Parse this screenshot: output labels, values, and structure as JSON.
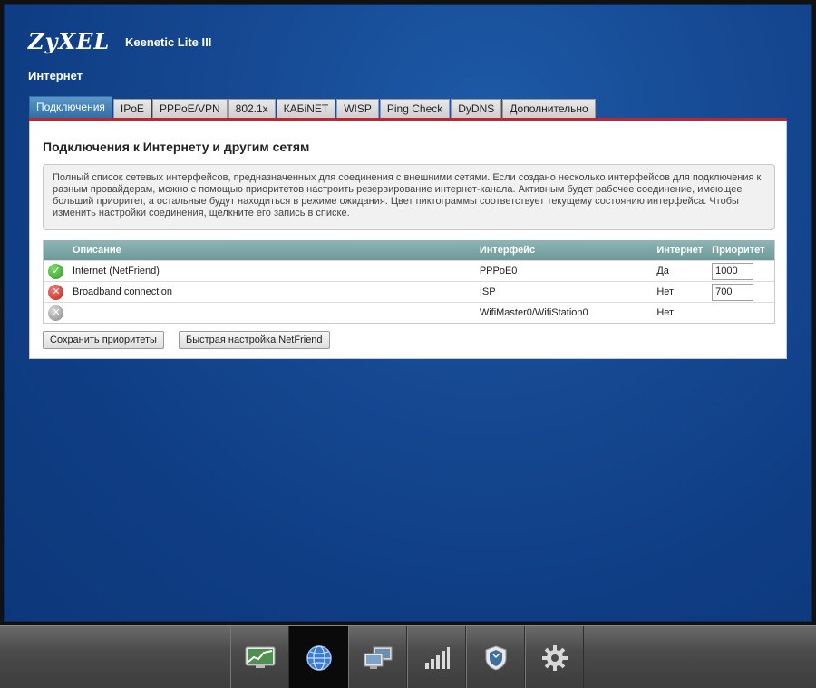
{
  "header": {
    "brand": "ZyXEL",
    "model": "Keenetic Lite III",
    "page_title": "Интернет"
  },
  "tabs": [
    {
      "label": "Подключения",
      "active": true
    },
    {
      "label": "IPoE"
    },
    {
      "label": "PPPoE/VPN"
    },
    {
      "label": "802.1x"
    },
    {
      "label": "КАБiNET"
    },
    {
      "label": "WISP"
    },
    {
      "label": "Ping Check"
    },
    {
      "label": "DyDNS"
    },
    {
      "label": "Дополнительно"
    }
  ],
  "panel": {
    "title": "Подключения к Интернету и другим сетям",
    "info": "Полный список сетевых интерфейсов, предназначенных для соединения с внешними сетями. Если создано несколько интерфейсов для подключения к разным провайдерам, можно с помощью приоритетов настроить резервирование интернет-канала. Активным будет рабочее соединение, имеющее больший приоритет, а остальные будут находиться в режиме ожидания. Цвет пиктограммы соответствует текущему состоянию интерфейса. Чтобы изменить настройки соединения, щелкните его запись в списке."
  },
  "table": {
    "headers": {
      "description": "Описание",
      "interface": "Интерфейс",
      "internet": "Интернет",
      "priority": "Приоритет"
    },
    "rows": [
      {
        "status": "ok",
        "status_icon": "check-icon",
        "description": "Internet (NetFriend)",
        "interface": "PPPoE0",
        "internet": "Да",
        "priority": "1000"
      },
      {
        "status": "error",
        "status_icon": "error-x-icon",
        "description": "Broadband connection",
        "interface": "ISP",
        "internet": "Нет",
        "priority": "700"
      },
      {
        "status": "disabled",
        "status_icon": "disabled-x-icon",
        "description": "",
        "interface": "WifiMaster0/WifiStation0",
        "internet": "Нет",
        "priority": ""
      }
    ]
  },
  "buttons": {
    "save_priorities": "Сохранить приоритеты",
    "quick_setup": "Быстрая настройка NetFriend"
  },
  "taskbar": {
    "items": [
      {
        "icon": "monitor-chart-icon"
      },
      {
        "icon": "globe-icon",
        "active": true
      },
      {
        "icon": "network-computers-icon"
      },
      {
        "icon": "signal-bars-icon"
      },
      {
        "icon": "security-shield-icon"
      },
      {
        "icon": "settings-gear-icon"
      }
    ]
  },
  "colors": {
    "background_blue": "#164a93",
    "accent_red": "#c8222d",
    "tab_active": "#2f6fa6",
    "table_header": "#7aa5a5",
    "status_ok": "#2e9b22",
    "status_error": "#c8221a",
    "status_disabled": "#8a8a8a"
  }
}
